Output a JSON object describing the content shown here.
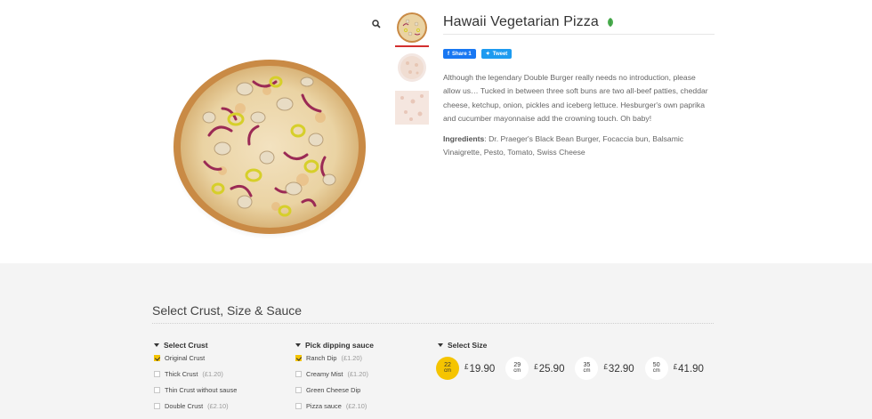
{
  "product": {
    "title": "Hawaii Vegetarian Pizza",
    "share_fb": "Share 1",
    "share_tw": "Tweet",
    "description": "Although the legendary Double Burger really needs no introduction, please allow us… Tucked in between three soft buns are two all-beef patties, cheddar cheese, ketchup, onion, pickles and iceberg lettuce. Hesburger's own paprika and cucumber mayonnaise add the crowning touch. Oh baby!",
    "ingredients_label": "Ingredients",
    "ingredients": ": Dr. Praeger's Black Bean Burger, Focaccia bun, Balsamic Vinaigrette, Pesto, Tomato, Swiss Cheese"
  },
  "options": {
    "section_title": "Select Crust, Size & Sauce",
    "crust": {
      "heading": "Select Crust",
      "items": [
        {
          "label": "Original Crust",
          "price": "",
          "checked": true
        },
        {
          "label": "Thick Crust",
          "price": "(£1.20)",
          "checked": false
        },
        {
          "label": "Thin Crust without sause",
          "price": "",
          "checked": false
        },
        {
          "label": "Double Crust",
          "price": "(£2.10)",
          "checked": false
        }
      ]
    },
    "sauce": {
      "heading": "Pick dipping sauce",
      "items": [
        {
          "label": "Ranch Dip",
          "price": "(£1.20)",
          "checked": true
        },
        {
          "label": "Creamy Mist",
          "price": "(£1.20)",
          "checked": false
        },
        {
          "label": "Green Cheese Dip",
          "price": "",
          "checked": false
        },
        {
          "label": "Pizza sauce",
          "price": "(£2.10)",
          "checked": false
        }
      ]
    },
    "size": {
      "heading": "Select Size",
      "items": [
        {
          "num": "22",
          "unit": "cm",
          "currency": "£",
          "price": "19.90",
          "selected": true
        },
        {
          "num": "29",
          "unit": "cm",
          "currency": "£",
          "price": "25.90",
          "selected": false
        },
        {
          "num": "35",
          "unit": "cm",
          "currency": "£",
          "price": "32.90",
          "selected": false
        },
        {
          "num": "50",
          "unit": "cm",
          "currency": "£",
          "price": "41.90",
          "selected": false
        }
      ]
    }
  },
  "colors": {
    "accent_yellow": "#f5c400",
    "active_thumb": "#d32f2f",
    "facebook": "#1877f2",
    "twitter": "#1d9bf0"
  }
}
